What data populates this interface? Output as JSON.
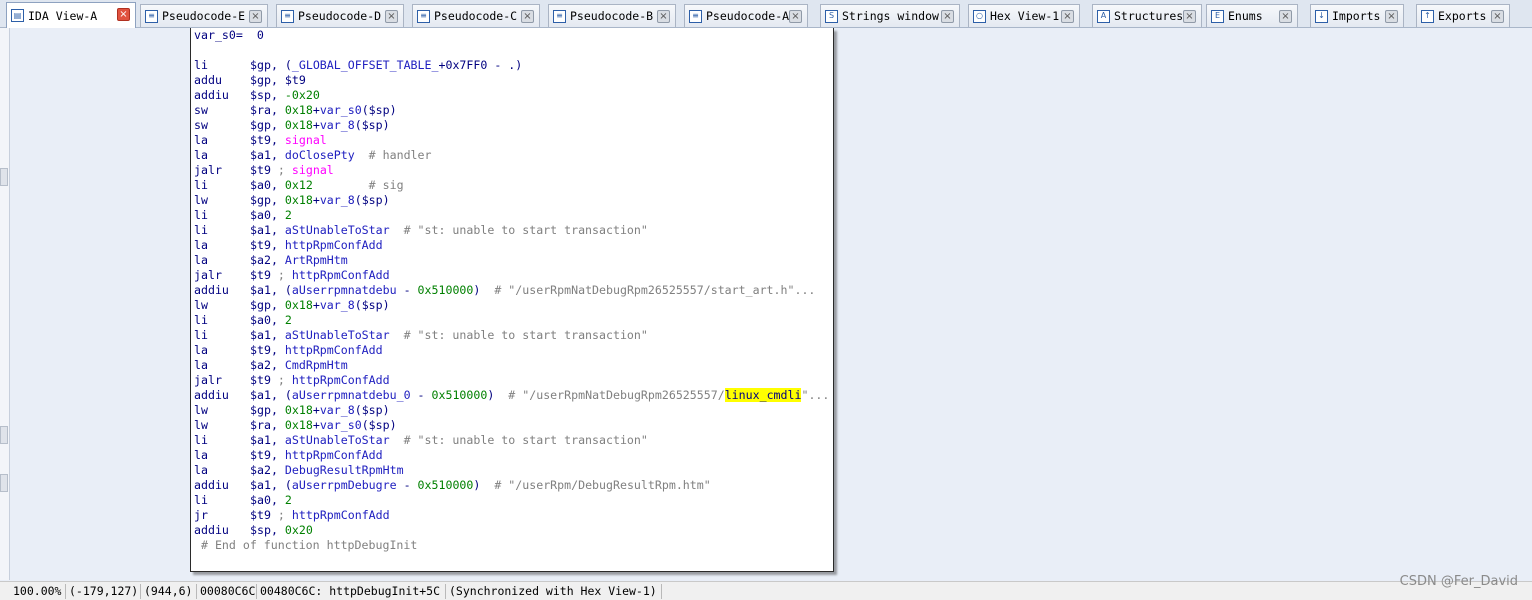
{
  "tabs": [
    {
      "label": "IDA View-A",
      "icon": "ida-view-icon",
      "active": true
    },
    {
      "label": "Pseudocode-E",
      "icon": "pseudocode-icon"
    },
    {
      "label": "Pseudocode-D",
      "icon": "pseudocode-icon"
    },
    {
      "label": "Pseudocode-C",
      "icon": "pseudocode-icon"
    },
    {
      "label": "Pseudocode-B",
      "icon": "pseudocode-icon"
    },
    {
      "label": "Pseudocode-A",
      "icon": "pseudocode-icon"
    },
    {
      "label": "Strings window",
      "icon": "strings-icon"
    },
    {
      "label": "Hex View-1",
      "icon": "hex-view-icon"
    },
    {
      "label": "Structures",
      "icon": "structures-icon"
    },
    {
      "label": "Enums",
      "icon": "enums-icon"
    },
    {
      "label": "Imports",
      "icon": "imports-icon"
    },
    {
      "label": "Exports",
      "icon": "exports-icon"
    }
  ],
  "code": {
    "header": "var_s0=  0",
    "lines": [
      {
        "mn": "li",
        "ops": [
          [
            "$gp, (",
            ""
          ],
          [
            "_GLOBAL_OFFSET_TABLE_",
            "var"
          ],
          [
            "+0x7FF0 - .)",
            ""
          ]
        ]
      },
      {
        "mn": "addu",
        "ops": [
          [
            "$gp, $t9",
            ""
          ]
        ]
      },
      {
        "mn": "addiu",
        "ops": [
          [
            "$sp, ",
            ""
          ],
          [
            "-0x20",
            "num"
          ]
        ]
      },
      {
        "mn": "sw",
        "ops": [
          [
            "$ra, ",
            ""
          ],
          [
            "0x18",
            "num"
          ],
          [
            "+",
            ""
          ],
          [
            "var_s0",
            "var"
          ],
          [
            "($sp)",
            ""
          ]
        ]
      },
      {
        "mn": "sw",
        "ops": [
          [
            "$gp, ",
            ""
          ],
          [
            "0x18",
            "num"
          ],
          [
            "+",
            ""
          ],
          [
            "var_8",
            "var"
          ],
          [
            "($sp)",
            ""
          ]
        ]
      },
      {
        "mn": "la",
        "ops": [
          [
            "$t9, ",
            ""
          ],
          [
            "signal",
            "imp"
          ]
        ]
      },
      {
        "mn": "la",
        "ops": [
          [
            "$a1, ",
            ""
          ],
          [
            "doClosePty",
            "var"
          ],
          [
            "  # handler",
            "cmt"
          ]
        ]
      },
      {
        "mn": "jalr",
        "ops": [
          [
            "$t9",
            ""
          ],
          [
            " ; ",
            "cmt"
          ],
          [
            "signal",
            "imp"
          ]
        ]
      },
      {
        "mn": "li",
        "ops": [
          [
            "$a0, ",
            ""
          ],
          [
            "0x12",
            "num"
          ],
          [
            "        # sig",
            "cmt"
          ]
        ]
      },
      {
        "mn": "lw",
        "ops": [
          [
            "$gp, ",
            ""
          ],
          [
            "0x18",
            "num"
          ],
          [
            "+",
            ""
          ],
          [
            "var_8",
            "var"
          ],
          [
            "($sp)",
            ""
          ]
        ]
      },
      {
        "mn": "li",
        "ops": [
          [
            "$a0, ",
            ""
          ],
          [
            "2",
            "num"
          ]
        ]
      },
      {
        "mn": "li",
        "ops": [
          [
            "$a1, ",
            ""
          ],
          [
            "aStUnableToStar",
            "var"
          ],
          [
            "  # \"st: unable to start transaction\"",
            "cmt"
          ]
        ]
      },
      {
        "mn": "la",
        "ops": [
          [
            "$t9, ",
            ""
          ],
          [
            "httpRpmConfAdd",
            "var"
          ]
        ]
      },
      {
        "mn": "la",
        "ops": [
          [
            "$a2, ",
            ""
          ],
          [
            "ArtRpmHtm",
            "var"
          ]
        ]
      },
      {
        "mn": "jalr",
        "ops": [
          [
            "$t9",
            ""
          ],
          [
            " ; ",
            "cmt"
          ],
          [
            "httpRpmConfAdd",
            "var"
          ]
        ]
      },
      {
        "mn": "addiu",
        "ops": [
          [
            "$a1, (",
            ""
          ],
          [
            "aUserrpmnatdebu",
            "var"
          ],
          [
            " - ",
            ""
          ],
          [
            "0x510000",
            "num"
          ],
          [
            ")",
            ""
          ],
          [
            "  # \"/userRpmNatDebugRpm26525557/start_art.h\"...",
            "cmt"
          ]
        ]
      },
      {
        "mn": "lw",
        "ops": [
          [
            "$gp, ",
            ""
          ],
          [
            "0x18",
            "num"
          ],
          [
            "+",
            ""
          ],
          [
            "var_8",
            "var"
          ],
          [
            "($sp)",
            ""
          ]
        ]
      },
      {
        "mn": "li",
        "ops": [
          [
            "$a0, ",
            ""
          ],
          [
            "2",
            "num"
          ]
        ]
      },
      {
        "mn": "li",
        "ops": [
          [
            "$a1, ",
            ""
          ],
          [
            "aStUnableToStar",
            "var"
          ],
          [
            "  # \"st: unable to start transaction\"",
            "cmt"
          ]
        ]
      },
      {
        "mn": "la",
        "ops": [
          [
            "$t9, ",
            ""
          ],
          [
            "httpRpmConfAdd",
            "var"
          ]
        ]
      },
      {
        "mn": "la",
        "ops": [
          [
            "$a2, ",
            ""
          ],
          [
            "CmdRpmHtm",
            "var"
          ]
        ]
      },
      {
        "mn": "jalr",
        "ops": [
          [
            "$t9",
            ""
          ],
          [
            " ; ",
            "cmt"
          ],
          [
            "httpRpmConfAdd",
            "var"
          ]
        ]
      },
      {
        "mn": "addiu",
        "ops": [
          [
            "$a1, (",
            ""
          ],
          [
            "aUserrpmnatdebu_0",
            "var"
          ],
          [
            " - ",
            ""
          ],
          [
            "0x510000",
            "num"
          ],
          [
            ")",
            ""
          ],
          [
            "  # \"/userRpmNatDebugRpm26525557/",
            "cmt"
          ],
          [
            "linux_cmdli",
            "hl"
          ],
          [
            "\"...",
            "cmt"
          ]
        ]
      },
      {
        "mn": "lw",
        "ops": [
          [
            "$gp, ",
            ""
          ],
          [
            "0x18",
            "num"
          ],
          [
            "+",
            ""
          ],
          [
            "var_8",
            "var"
          ],
          [
            "($sp)",
            ""
          ]
        ]
      },
      {
        "mn": "lw",
        "ops": [
          [
            "$ra, ",
            ""
          ],
          [
            "0x18",
            "num"
          ],
          [
            "+",
            ""
          ],
          [
            "var_s0",
            "var"
          ],
          [
            "($sp)",
            ""
          ]
        ]
      },
      {
        "mn": "li",
        "ops": [
          [
            "$a1, ",
            ""
          ],
          [
            "aStUnableToStar",
            "var"
          ],
          [
            "  # \"st: unable to start transaction\"",
            "cmt"
          ]
        ]
      },
      {
        "mn": "la",
        "ops": [
          [
            "$t9, ",
            ""
          ],
          [
            "httpRpmConfAdd",
            "var"
          ]
        ]
      },
      {
        "mn": "la",
        "ops": [
          [
            "$a2, ",
            ""
          ],
          [
            "DebugResultRpmHtm",
            "var"
          ]
        ]
      },
      {
        "mn": "addiu",
        "ops": [
          [
            "$a1, (",
            ""
          ],
          [
            "aUserrpmDebugre",
            "var"
          ],
          [
            " - ",
            ""
          ],
          [
            "0x510000",
            "num"
          ],
          [
            ")",
            ""
          ],
          [
            "  # \"/userRpm/DebugResultRpm.htm\"",
            "cmt"
          ]
        ]
      },
      {
        "mn": "li",
        "ops": [
          [
            "$a0, ",
            ""
          ],
          [
            "2",
            "num"
          ]
        ]
      },
      {
        "mn": "jr",
        "ops": [
          [
            "$t9",
            ""
          ],
          [
            " ; ",
            "cmt"
          ],
          [
            "httpRpmConfAdd",
            "var"
          ]
        ]
      },
      {
        "mn": "addiu",
        "ops": [
          [
            "$sp, ",
            ""
          ],
          [
            "0x20",
            "num"
          ]
        ]
      }
    ],
    "footer": " # End of function httpDebugInit"
  },
  "status": {
    "zoom": "100.00%",
    "coords": "(-179,127)",
    "graph_pos": "(944,6)",
    "offset": "00080C6C",
    "address": "00480C6C: httpDebugInit+5C",
    "sync": "(Synchronized with Hex View-1)"
  },
  "watermark": "CSDN @Fer_David"
}
